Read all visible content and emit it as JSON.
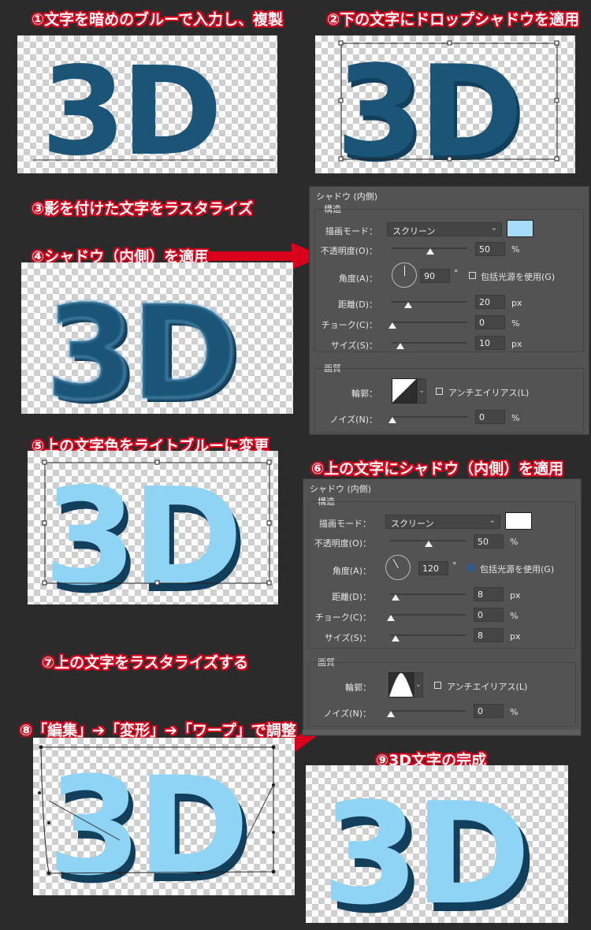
{
  "steps": {
    "s1": "①文字を暗めのブルーで入力し、複製",
    "s2": "②下の文字にドロップシャドウを適用",
    "s3": "③影を付けた文字をラスタライズ",
    "s4": "④シャドウ（内側）を適用",
    "s5": "⑤上の文字色をライトブルーに変更",
    "s6": "⑥上の文字にシャドウ（内側）を適用",
    "s7": "⑦上の文字をラスタライズする",
    "s8": "⑧「編集」➔「変形」➔「ワープ」で調整",
    "s9": "⑨3D文字の完成"
  },
  "art_text": "3D",
  "colors": {
    "dark_blue": "#1a5578",
    "shadow_blue": "#123f5c",
    "light_blue": "#8fd4f4",
    "red": "#d9001b",
    "panel_bg": "#535353"
  },
  "panel1": {
    "title": "シャドウ (内側)",
    "structure": "構造",
    "blend_mode_label": "描画モード：",
    "blend_mode": "スクリーン",
    "opacity_label": "不透明度(O)：",
    "opacity": "50",
    "angle_label": "角度(A)：",
    "angle": "90",
    "global_light": "包括光源を使用(G)",
    "distance_label": "距離(D)：",
    "distance": "20",
    "choke_label": "チョーク(C)：",
    "choke": "0",
    "size_label": "サイズ(S)：",
    "size": "10",
    "quality": "画質",
    "contour_label": "輪郭：",
    "antialias": "アンチエイリアス(L)",
    "noise_label": "ノイズ(N)：",
    "noise": "0",
    "unit_pct": "%",
    "unit_px": "px",
    "unit_deg": "°",
    "swatch_color": "#a6dcf6"
  },
  "panel2": {
    "title": "シャドウ (内側)",
    "structure": "構造",
    "blend_mode_label": "描画モード：",
    "blend_mode": "スクリーン",
    "opacity_label": "不透明度(O)：",
    "opacity": "50",
    "angle_label": "角度(A)：",
    "angle": "120",
    "global_light": "包括光源を使用(G)",
    "distance_label": "距離(D)：",
    "distance": "8",
    "choke_label": "チョーク(C)：",
    "choke": "0",
    "size_label": "サイズ(S)：",
    "size": "8",
    "quality": "画質",
    "contour_label": "輪郭：",
    "antialias": "アンチエイリアス(L)",
    "noise_label": "ノイズ(N)：",
    "noise": "0",
    "unit_pct": "%",
    "unit_px": "px",
    "unit_deg": "°",
    "swatch_color": "#ffffff"
  }
}
